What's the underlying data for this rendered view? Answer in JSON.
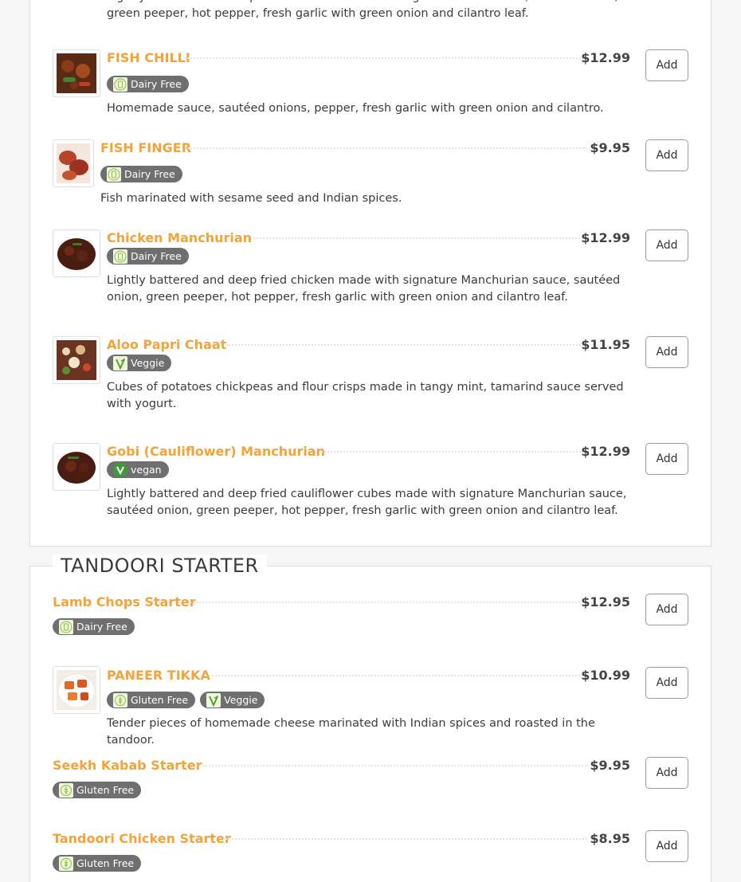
{
  "top_section": {
    "partial_desc": "Lightly battered and deep fried chicken made with signature chilli sauce, sautéed onion, green peeper, hot pepper, fresh garlic with green onion and cilantro leaf.",
    "items": [
      {
        "name": "FISH CHILLI",
        "price": "$12.99",
        "badges": [
          "Dairy Free"
        ],
        "desc": "Homemade sauce, sautéed onions, pepper, fresh garlic with green onion and cilantro.",
        "add": "Add"
      },
      {
        "name": "FISH FINGER",
        "price": "$9.95",
        "badges": [
          "Dairy Free"
        ],
        "desc": "Fish marinated with sesame seed and Indian spices.",
        "add": "Add"
      },
      {
        "name": "Chicken Manchurian",
        "price": "$12.99",
        "badges": [
          "Dairy Free"
        ],
        "desc": "Lightly battered and deep fried chicken made with signature Manchurian sauce, sautéed onion, green peeper, hot pepper, fresh garlic with green onion and cilantro leaf.",
        "add": "Add"
      },
      {
        "name": "Aloo Papri Chaat",
        "price": "$11.95",
        "badges": [
          "Veggie"
        ],
        "desc": "Cubes of potatoes chickpeas and flour crisps made in tangy mint, tamarind sauce served with yogurt.",
        "add": "Add"
      },
      {
        "name": "Gobi (Cauliflower) Manchurian",
        "price": "$12.99",
        "badges": [
          "vegan"
        ],
        "desc": "Lightly battered and deep fried cauliflower cubes made with signature Manchurian sauce, sautéed onion, green peeper, hot pepper, fresh garlic with green onion and cilantro leaf.",
        "add": "Add"
      }
    ]
  },
  "tandoori": {
    "title": "TANDOORI STARTER",
    "items": [
      {
        "name": "Lamb Chops Starter",
        "price": "$12.95",
        "badges": [
          "Dairy Free"
        ],
        "add": "Add"
      },
      {
        "name": "PANEER TIKKA",
        "price": "$10.99",
        "badges": [
          "Gluten Free",
          "Veggie"
        ],
        "desc": "Tender pieces of homemade cheese marinated with Indian spices and roasted in the tandoor.",
        "add": "Add"
      },
      {
        "name": "Seekh Kabab Starter",
        "price": "$9.95",
        "badges": [
          "Gluten Free"
        ],
        "add": "Add"
      },
      {
        "name": "Tandoori Chicken Starter",
        "price": "$8.95",
        "badges": [
          "Gluten Free"
        ],
        "add": "Add"
      }
    ]
  },
  "colors": {
    "item_name": "#f2a33a",
    "badge_bg": "#6f6f6f",
    "price": "#444444"
  },
  "icons": {
    "dairy_free": "bottle-icon",
    "veggie": "leaf-icon",
    "vegan": "vegan-icon",
    "gluten_free": "wheat-icon"
  }
}
